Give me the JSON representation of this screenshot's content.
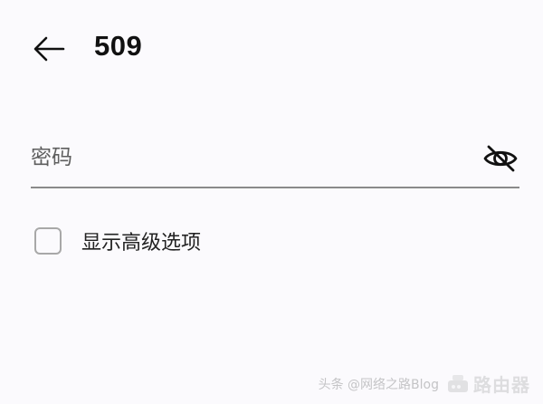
{
  "header": {
    "title": "509",
    "back_icon": "arrow-left-icon"
  },
  "form": {
    "password_placeholder": "密码",
    "password_value": "",
    "visibility_icon": "eye-off-icon",
    "advanced_option_label": "显示高级选项",
    "advanced_option_checked": false
  },
  "watermark": {
    "text": "头条 @网络之路Blog",
    "brand": "路由器"
  }
}
